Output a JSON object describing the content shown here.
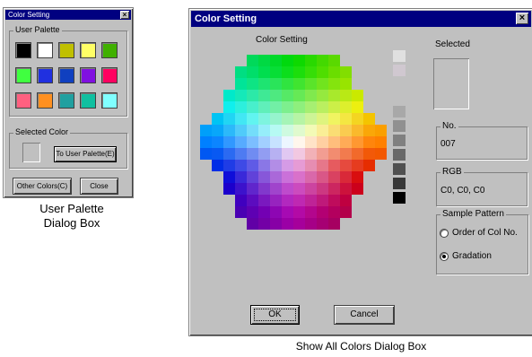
{
  "small_dialog": {
    "title": "Color Setting",
    "close_glyph": "×",
    "user_palette_label": "User Palette",
    "palette": [
      "#000000",
      "#ffffff",
      "#c0c000",
      "#ffff66",
      "#40b000",
      "#40ff40",
      "#2030e0",
      "#1040c0",
      "#8010e0",
      "#ff0060",
      "#ff6080",
      "#ff9020",
      "#20a0a0",
      "#10c0a0",
      "#80ffff"
    ],
    "selected_color_label": "Selected Color",
    "to_user_palette_label": "To User Palette(E)",
    "other_colors_label": "Other Colors(C)",
    "close_label": "Close",
    "caption_line1": "User Palette",
    "caption_line2": "Dialog Box"
  },
  "large_dialog": {
    "title": "Color Setting",
    "close_glyph": "×",
    "color_setting_label": "Color Setting",
    "selected_label": "Selected",
    "no_label": "No.",
    "no_value": "007",
    "rgb_label": "RGB",
    "rgb_value": "C0, C0, C0",
    "sample_pattern_label": "Sample Pattern",
    "option_order": "Order of Col No.",
    "option_gradation": "Gradation",
    "selected_option": "gradation",
    "ok_label": "OK",
    "cancel_label": "Cancel",
    "gray_ramp": [
      "#e0e0e0",
      "#d0c8d0",
      "#c0c0c0",
      "#a8a8a8",
      "#909090",
      "#808080",
      "#686868",
      "#505050",
      "#383838",
      "#000000"
    ],
    "caption": "Show All Colors Dialog Box"
  }
}
